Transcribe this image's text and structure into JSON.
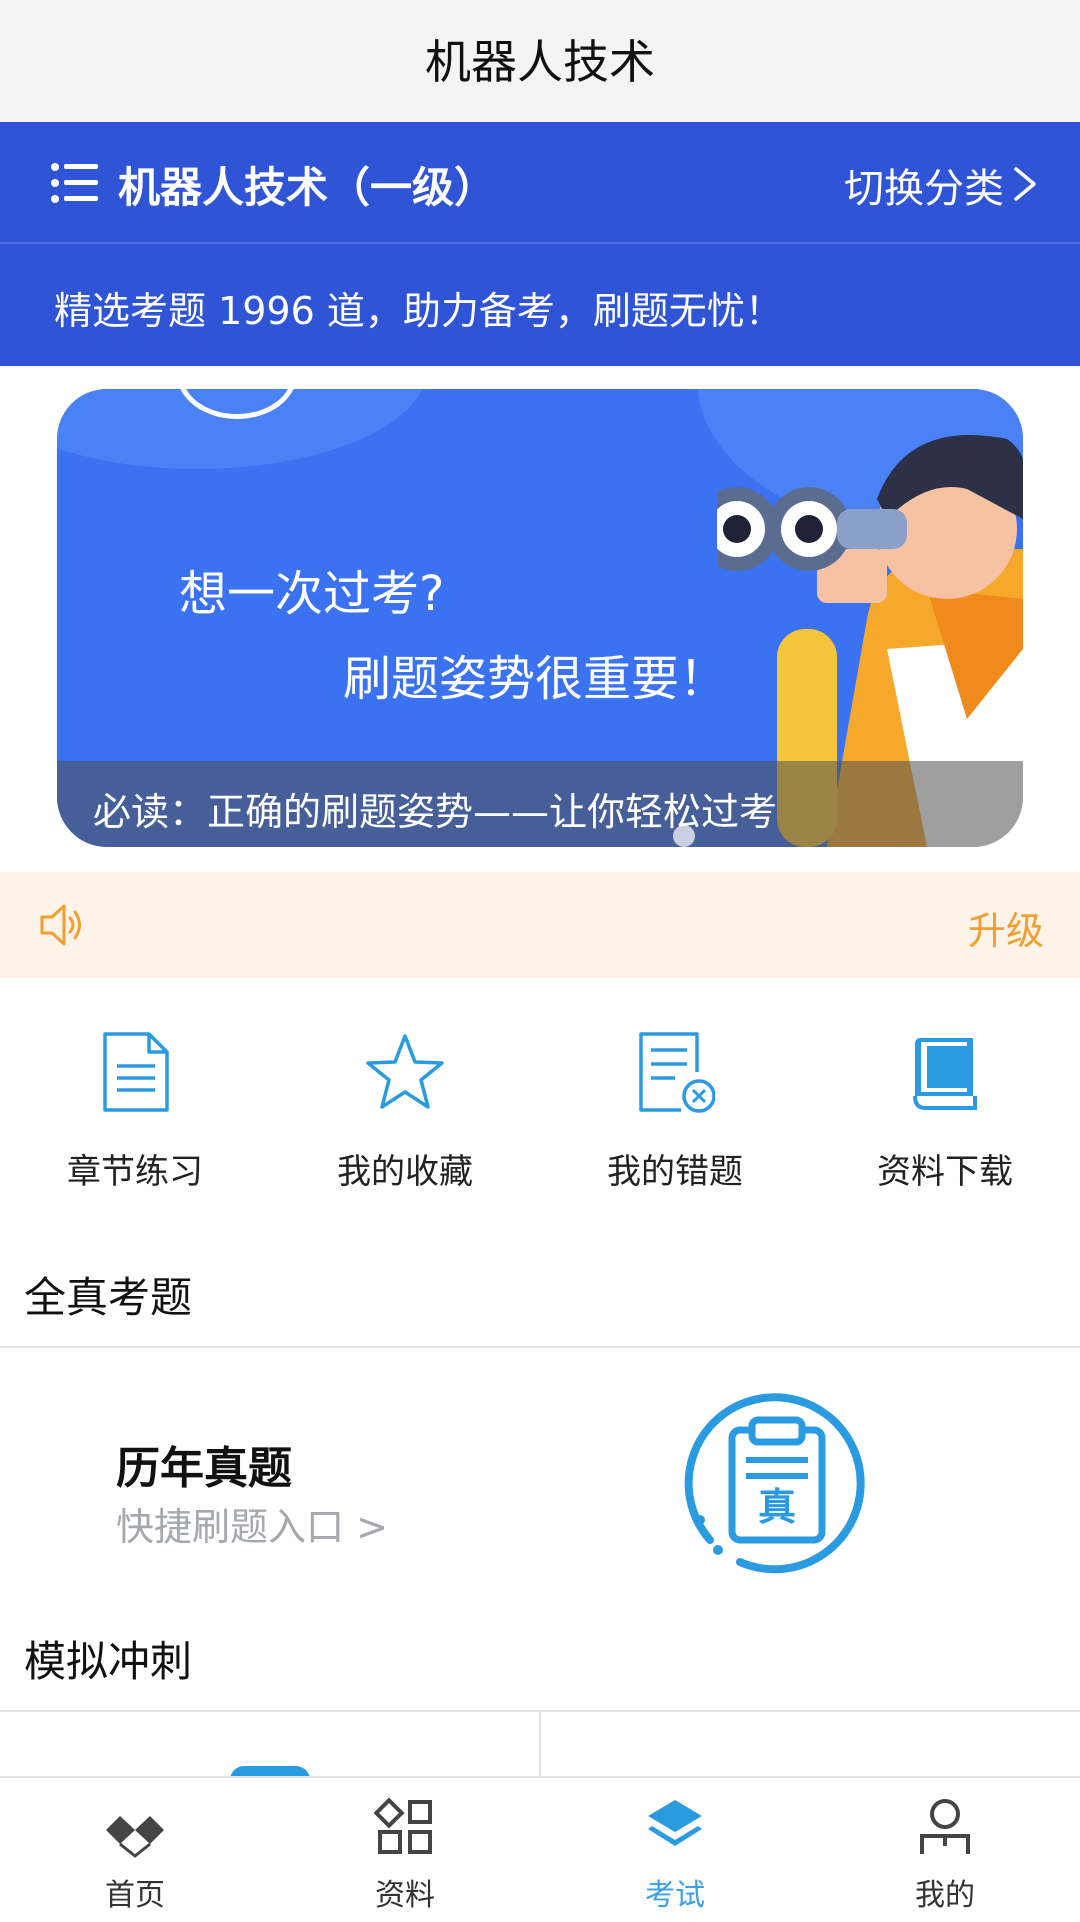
{
  "title_bar": {
    "title": "机器人技术"
  },
  "header": {
    "category_title": "机器人技术（一级）",
    "switch_label": "切换分类",
    "promo_text": "精选考题 1996 道，助力备考，刷题无忧！"
  },
  "banner": {
    "line1": "想一次过考?",
    "line2": "刷题姿势很重要！",
    "caption": "必读：正确的刷题姿势——让你轻松过考"
  },
  "notice": {
    "upgrade_label": "升级"
  },
  "quick_actions": [
    {
      "label": "章节练习",
      "icon": "document-icon"
    },
    {
      "label": "我的收藏",
      "icon": "star-icon"
    },
    {
      "label": "我的错题",
      "icon": "wrong-questions-icon"
    },
    {
      "label": "资料下载",
      "icon": "book-icon"
    }
  ],
  "sections": {
    "real_exam_title": "全真考题",
    "past_papers_title": "历年真题",
    "past_papers_sub": "快捷刷题入口 >",
    "past_papers_badge": "真",
    "mock_title": "模拟冲刺"
  },
  "bottom_nav": [
    {
      "label": "首页",
      "icon": "home-icon",
      "active": false
    },
    {
      "label": "资料",
      "icon": "grid-icon",
      "active": false
    },
    {
      "label": "考试",
      "icon": "layers-icon",
      "active": true
    },
    {
      "label": "我的",
      "icon": "user-icon",
      "active": false
    }
  ],
  "colors": {
    "header_blue": "#3054d6",
    "accent_blue": "#2a9be0",
    "upgrade_orange": "#f0a030",
    "nav_active": "#3aa0e8"
  }
}
